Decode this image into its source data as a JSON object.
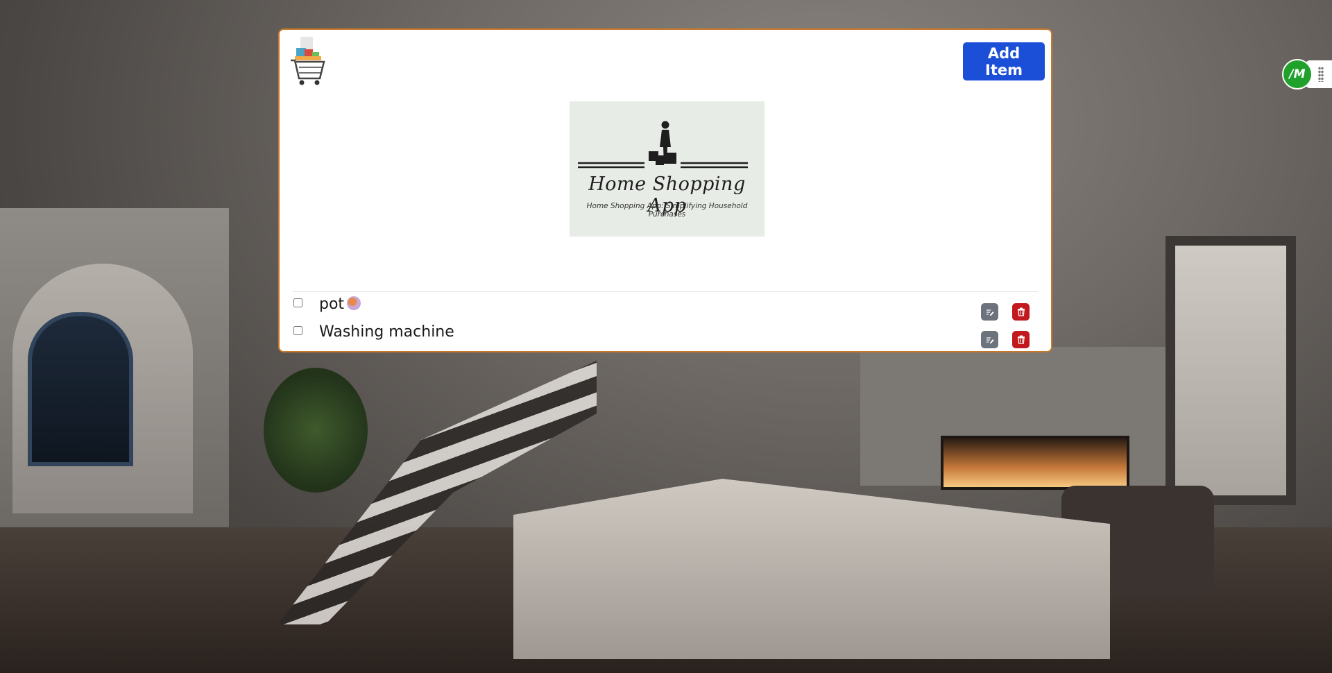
{
  "header": {
    "add_item_label": "Add Item"
  },
  "hero": {
    "title": "Home Shopping App",
    "subtitle": "Home Shopping App: Simplifying Household Purchases"
  },
  "items": [
    {
      "label": "pot",
      "checked": false
    },
    {
      "label": "Washing machine",
      "checked": false
    }
  ],
  "extension": {
    "badge_text": "/M"
  },
  "colors": {
    "primary_button": "#1b4fd8",
    "card_border": "#c8782a",
    "edit_button": "#6d737c",
    "delete_button": "#c2191e",
    "extension_badge": "#1fa12c"
  },
  "icons": {
    "app_logo": "shopping-cart-icon",
    "edit": "edit-icon",
    "delete": "trash-icon"
  }
}
